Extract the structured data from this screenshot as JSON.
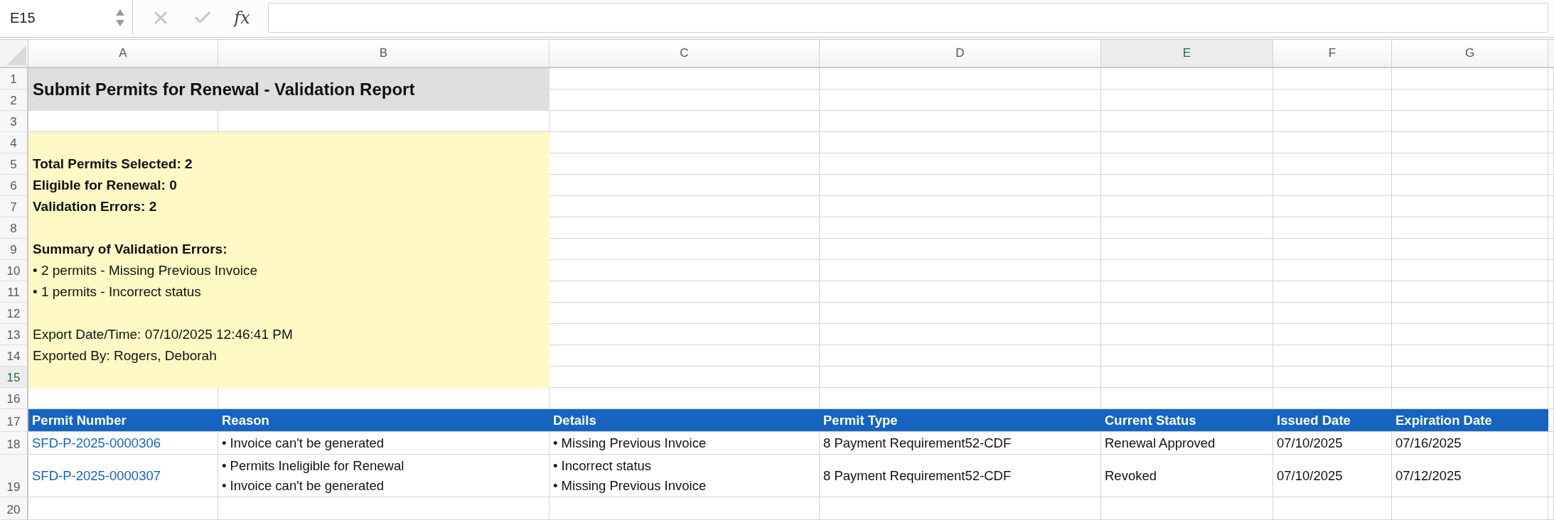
{
  "formula_bar": {
    "name_box": "E15",
    "function_label": "fx"
  },
  "column_headers": [
    {
      "label": "A",
      "selected": false
    },
    {
      "label": "B",
      "selected": false
    },
    {
      "label": "C",
      "selected": false
    },
    {
      "label": "D",
      "selected": false
    },
    {
      "label": "E",
      "selected": true
    },
    {
      "label": "F",
      "selected": false
    },
    {
      "label": "G",
      "selected": false
    }
  ],
  "row_headers": [
    {
      "label": "1",
      "selected": false
    },
    {
      "label": "2",
      "selected": false
    },
    {
      "label": "3",
      "selected": false
    },
    {
      "label": "4",
      "selected": false
    },
    {
      "label": "5",
      "selected": false
    },
    {
      "label": "6",
      "selected": false
    },
    {
      "label": "7",
      "selected": false
    },
    {
      "label": "8",
      "selected": false
    },
    {
      "label": "9",
      "selected": false
    },
    {
      "label": "10",
      "selected": false
    },
    {
      "label": "11",
      "selected": false
    },
    {
      "label": "12",
      "selected": false
    },
    {
      "label": "13",
      "selected": false
    },
    {
      "label": "14",
      "selected": false
    },
    {
      "label": "15",
      "selected": true
    },
    {
      "label": "16",
      "selected": false
    },
    {
      "label": "17",
      "selected": false
    },
    {
      "label": "18",
      "selected": false
    },
    {
      "label": "19",
      "selected": false
    },
    {
      "label": "20",
      "selected": false
    }
  ],
  "title": "Submit Permits for Renewal - Validation Report",
  "summary": {
    "stats": [
      "Total Permits Selected: 2",
      "Eligible for Renewal: 0",
      "Validation Errors: 2"
    ],
    "errors_heading": "Summary of Validation Errors:",
    "errors": [
      "• 2 permits - Missing Previous Invoice",
      "• 1 permits - Incorrect status"
    ],
    "export_info": [
      "Export Date/Time: 07/10/2025 12:46:41 PM",
      "Exported By: Rogers, Deborah"
    ]
  },
  "table": {
    "columns": [
      "Permit Number",
      "Reason",
      "Details",
      "Permit Type",
      "Current Status",
      "Issued Date",
      "Expiration Date"
    ],
    "rows": [
      {
        "permit_number": "SFD-P-2025-0000306",
        "reason": [
          "• Invoice can't be generated"
        ],
        "details": [
          "• Missing Previous Invoice"
        ],
        "permit_type": "8 Payment Requirement52-CDF",
        "current_status": "Renewal Approved",
        "issued_date": "07/10/2025",
        "expiration_date": "07/16/2025"
      },
      {
        "permit_number": "SFD-P-2025-0000307",
        "reason": [
          "• Permits Ineligible for Renewal",
          "• Invoice can't be generated"
        ],
        "details": [
          "• Incorrect status",
          "• Missing Previous Invoice"
        ],
        "permit_type": "8 Payment Requirement52-CDF",
        "current_status": "Revoked",
        "issued_date": "07/10/2025",
        "expiration_date": "07/12/2025"
      }
    ]
  }
}
